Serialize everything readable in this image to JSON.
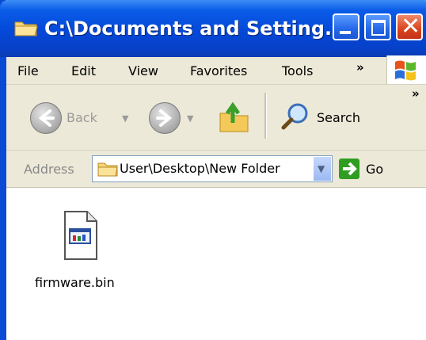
{
  "window": {
    "title": "C:\\Documents and Setting...",
    "close_glyph": "✕"
  },
  "menu": {
    "items": [
      "File",
      "Edit",
      "View",
      "Favorites",
      "Tools"
    ],
    "overflow": "»"
  },
  "toolbar": {
    "back_label": "Back",
    "search_label": "Search",
    "overflow": "»"
  },
  "address": {
    "label": "Address",
    "value": "User\\Desktop\\New Folder",
    "go_label": "Go"
  },
  "files": [
    {
      "name": "firmware.bin",
      "icon": "binary-file-icon"
    }
  ],
  "colors": {
    "titlebar": "#0548d8",
    "chrome": "#ece9d8",
    "close": "#d9441c",
    "go": "#2f9d22"
  }
}
